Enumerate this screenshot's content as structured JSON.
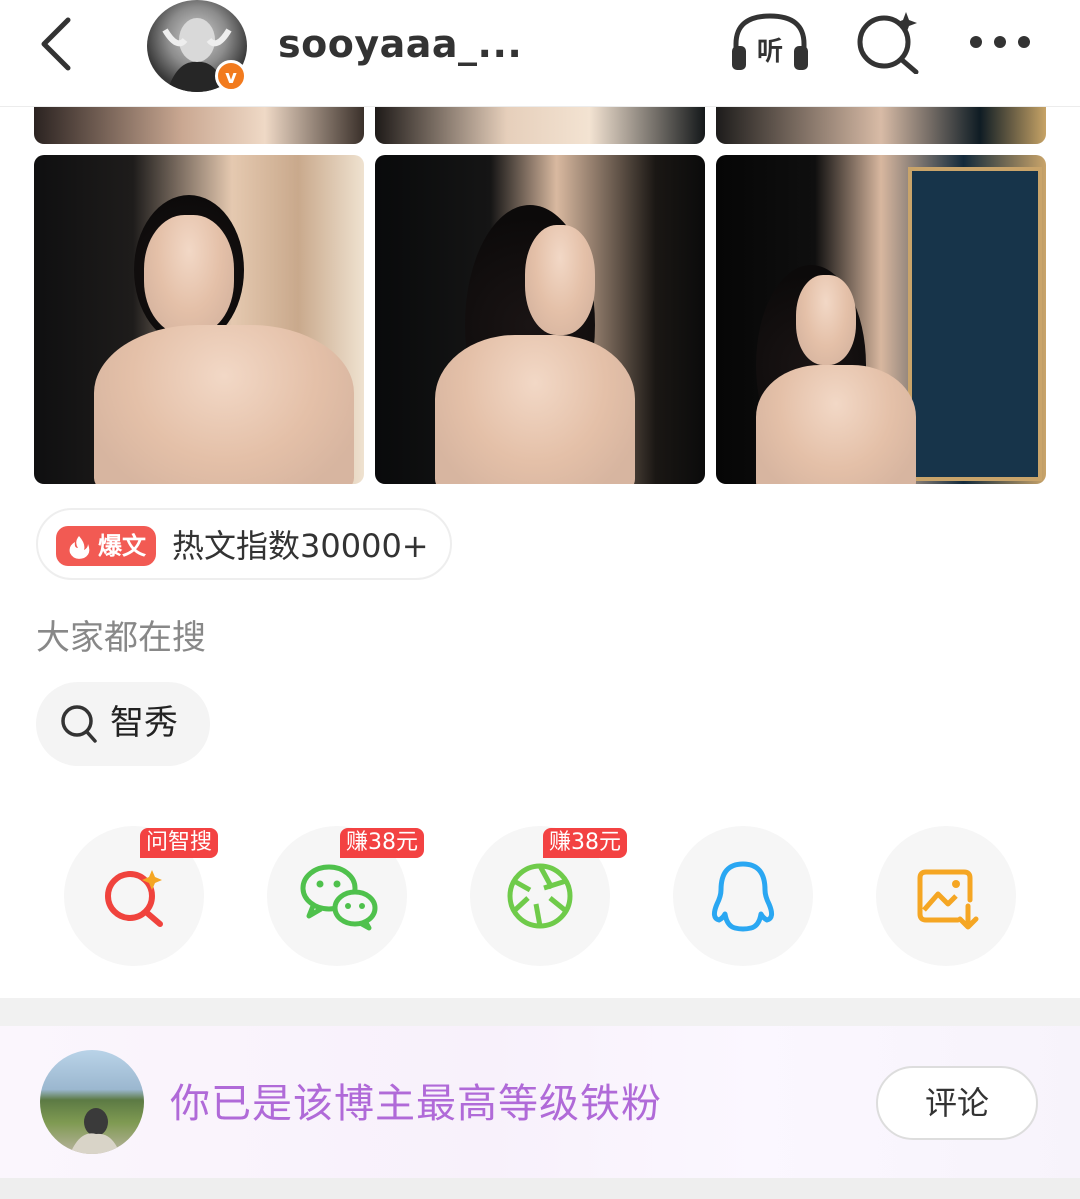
{
  "header": {
    "username": "sooyaaa_...",
    "verified_badge": "v",
    "listen_label": "听",
    "icons": [
      "back-icon",
      "listen-icon",
      "ai-search-icon",
      "more-icon"
    ]
  },
  "hot": {
    "tag_label": "爆文",
    "text": "热文指数30000+"
  },
  "search": {
    "heading": "大家都在搜",
    "chip": "智秀"
  },
  "share": [
    {
      "name": "ai-search",
      "tag": "问智搜",
      "color": "#f0433d"
    },
    {
      "name": "wechat",
      "tag": "赚38元",
      "color": "#4fc14c"
    },
    {
      "name": "moments",
      "tag": "赚38元",
      "color": "#6fcb4a"
    },
    {
      "name": "qq",
      "tag": "",
      "color": "#2aa7f2"
    },
    {
      "name": "save-image",
      "tag": "",
      "color": "#f5a623"
    }
  ],
  "fan": {
    "message": "你已是该博主最高等级铁粉",
    "comment_label": "评论",
    "message_color": "#b06ad8"
  }
}
